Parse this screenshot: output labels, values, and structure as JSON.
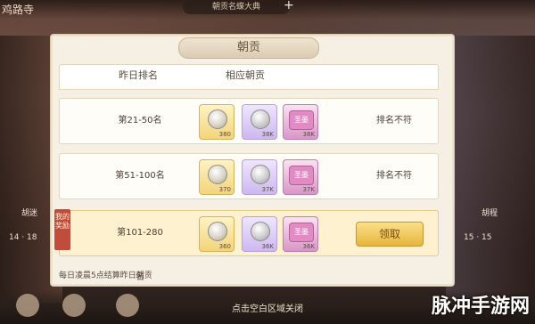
{
  "top": {
    "left_tag": "鸡路寺",
    "pill": "朝贡名蝶大典",
    "plus": "+"
  },
  "side_tags": {
    "left": "胡迷",
    "right": "胡程",
    "left_num": "14 · 18",
    "right_num": "15 · 15"
  },
  "panel": {
    "title": "朝贡",
    "headers": {
      "rank": "昨日排名",
      "tribute": "相应朝贡"
    },
    "rows": [
      {
        "rank": "第21-50名",
        "rewards": [
          {
            "type": "gold",
            "qty": "380"
          },
          {
            "type": "purple",
            "qty": "38K"
          },
          {
            "type": "pink",
            "qty": "38K",
            "stamp": "圣墨"
          }
        ],
        "status": "排名不符",
        "mine": false
      },
      {
        "rank": "第51-100名",
        "rewards": [
          {
            "type": "gold",
            "qty": "370"
          },
          {
            "type": "purple",
            "qty": "37K"
          },
          {
            "type": "pink",
            "qty": "37K",
            "stamp": "圣墨"
          }
        ],
        "status": "排名不符",
        "mine": false
      },
      {
        "rank": "第101-280名",
        "rewards": [
          {
            "type": "gold",
            "qty": "360"
          },
          {
            "type": "purple",
            "qty": "36K"
          },
          {
            "type": "pink",
            "qty": "36K",
            "stamp": "圣墨"
          }
        ],
        "status": "",
        "mine": true,
        "ribbon": "我的奖励",
        "button": "领取"
      }
    ],
    "note": "每日凌晨5点结算昨日朝贡"
  },
  "bottom": {
    "hint": "点击空白区域关闭"
  },
  "watermark": "脉冲手游网",
  "colors": {
    "panel_bg": "#f6efe4",
    "mine_row": "#fdf1cf",
    "button": "#e6b53c"
  }
}
